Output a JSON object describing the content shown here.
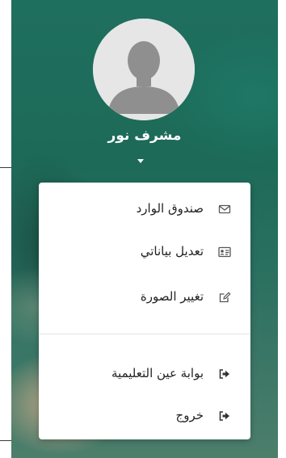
{
  "user": {
    "name": "مشرف نور"
  },
  "menu": {
    "items": [
      {
        "label": "صندوق الوارد",
        "icon": "envelope-icon"
      },
      {
        "label": "تعديل بياناتي",
        "icon": "id-card-icon"
      },
      {
        "label": "تغيير الصورة",
        "icon": "edit-icon"
      }
    ],
    "secondary_items": [
      {
        "label": "بوابة عين التعليمية",
        "icon": "sign-in-icon"
      },
      {
        "label": "خروج",
        "icon": "sign-out-icon"
      }
    ]
  },
  "colors": {
    "panel_green": "#1f6f5f",
    "menu_text": "#222222",
    "icon_gray": "#555555"
  }
}
